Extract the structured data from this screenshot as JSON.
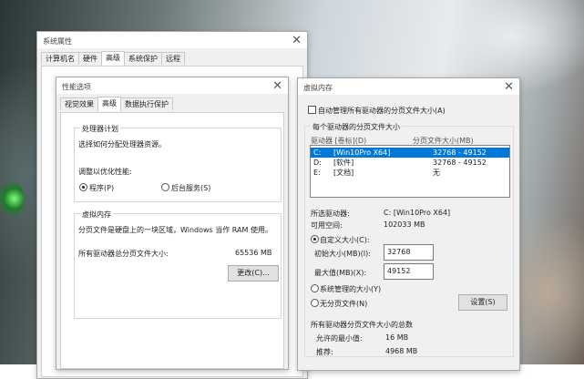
{
  "sys": {
    "title": "系统属性",
    "tabs": [
      "计算机名",
      "硬件",
      "高级",
      "系统保护",
      "远程"
    ]
  },
  "perf": {
    "title": "性能选项",
    "tabs": [
      "视觉效果",
      "高级",
      "数据执行保护"
    ],
    "sched_title": "处理器计划",
    "sched_desc": "选择如何分配处理器资源。",
    "adjust_label": "调整以优化性能:",
    "opt_programs": "程序(P)",
    "opt_services": "后台服务(S)",
    "vm_title": "虚拟内存",
    "vm_desc": "分页文件是硬盘上的一块区域，Windows 当作 RAM 使用。",
    "vm_total_label": "所有驱动器总分页文件大小:",
    "vm_total_value": "65536 MB",
    "change_button": "更改(C)..."
  },
  "vm": {
    "title": "虚拟内存",
    "auto_manage": "自动管理所有驱动器的分页文件大小(A)",
    "per_drive_title": "每个驱动器的分页文件大小",
    "col_drive": "驱动器 [卷标](D)",
    "col_size": "分页文件大小(MB)",
    "drives": [
      {
        "drive": "C:",
        "label": "[Win10Pro X64]",
        "size": "32768 - 49152"
      },
      {
        "drive": "D:",
        "label": "[软件]",
        "size": "32768 - 49152"
      },
      {
        "drive": "E:",
        "label": "[文档]",
        "size": "无"
      }
    ],
    "sel_drive_label": "所选驱动器:",
    "sel_drive_value": "C:  [Win10Pro X64]",
    "avail_label": "可用空间:",
    "avail_value": "102033 MB",
    "custom_size": "自定义大小(C):",
    "initial_label": "初始大小(MB)(I):",
    "initial_value": "32768",
    "max_label": "最大值(MB)(X):",
    "max_value": "49152",
    "system_managed": "系统管理的大小(Y)",
    "no_paging": "无分页文件(N)",
    "set_button": "设置(S)",
    "total_title": "所有驱动器分页文件大小的总数",
    "min_label": "允许的最小值:",
    "min_value": "16 MB",
    "rec_label": "推荐:",
    "rec_value": "4968 MB"
  }
}
